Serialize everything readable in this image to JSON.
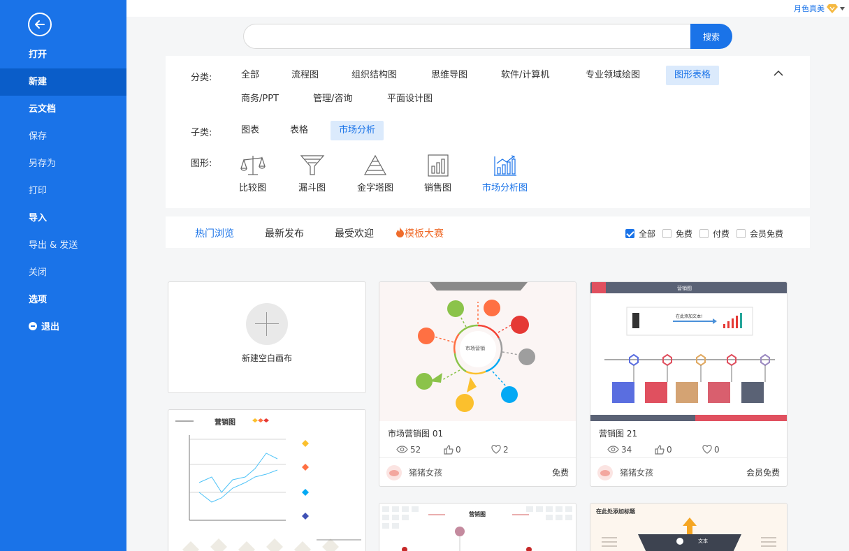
{
  "sidebar": {
    "items": [
      {
        "label": "打开"
      },
      {
        "label": "新建"
      },
      {
        "label": "云文档"
      },
      {
        "label": "保存"
      },
      {
        "label": "另存为"
      },
      {
        "label": "打印"
      },
      {
        "label": "导入"
      },
      {
        "label": "导出 & 发送"
      },
      {
        "label": "关闭"
      },
      {
        "label": "选项"
      },
      {
        "label": "退出"
      }
    ]
  },
  "user": {
    "name": "月色真美"
  },
  "search": {
    "value": "",
    "placeholder": "",
    "button": "搜索"
  },
  "filters": {
    "category_label": "分类:",
    "categories": [
      "全部",
      "流程图",
      "组织结构图",
      "思维导图",
      "软件/计算机",
      "专业领域绘图",
      "图形表格",
      "商务/PPT",
      "管理/咨询",
      "平面设计图"
    ],
    "category_selected": "图形表格",
    "sub_label": "子类:",
    "subcategories": [
      "图表",
      "表格",
      "市场分析"
    ],
    "sub_selected": "市场分析",
    "shape_label": "图形:",
    "shapes": [
      "比较图",
      "漏斗图",
      "金字塔图",
      "销售图",
      "市场分析图"
    ],
    "shape_selected": "市场分析图"
  },
  "sort": {
    "tabs": [
      "热门浏览",
      "最新发布",
      "最受欢迎",
      "模板大赛"
    ],
    "selected": "热门浏览",
    "checks": [
      {
        "label": "全部",
        "checked": true
      },
      {
        "label": "免费",
        "checked": false
      },
      {
        "label": "付费",
        "checked": false
      },
      {
        "label": "会员免费",
        "checked": false
      }
    ]
  },
  "blank_card": {
    "label": "新建空白画布"
  },
  "templates": [
    {
      "title": "市场营销图 01",
      "views": "52",
      "likes": "0",
      "favs": "2",
      "author": "猪猪女孩",
      "price": "免费",
      "thumb_text": "市场营销"
    },
    {
      "title": "营销图 21",
      "views": "34",
      "likes": "0",
      "favs": "0",
      "author": "猪猪女孩",
      "price": "会员免费",
      "thumb_heading": "营销图",
      "thumb_box_text": "在此添加文本!"
    }
  ],
  "partial_cards": [
    {
      "thumb_heading": "营销图"
    },
    {
      "thumb_heading": "营销图"
    },
    {
      "thumb_heading": "在此处添加标题",
      "thumb_label": "文本"
    }
  ],
  "colors": {
    "accent": "#1a73e8",
    "fire": "#ef6c2b"
  }
}
